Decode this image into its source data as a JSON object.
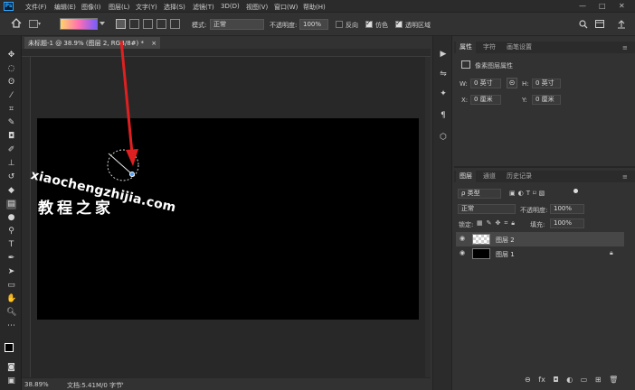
{
  "app": {
    "logo": "Ps"
  },
  "menu": [
    "文件(F)",
    "编辑(E)",
    "图像(I)",
    "图层(L)",
    "文字(Y)",
    "选择(S)",
    "滤镜(T)",
    "3D(D)",
    "视图(V)",
    "窗口(W)",
    "帮助(H)"
  ],
  "window_controls": {
    "minimize": "—",
    "maximize": "□",
    "close": "✕"
  },
  "options": {
    "mode_label": "模式:",
    "mode_value": "正常",
    "opacity_label": "不透明度:",
    "opacity_value": "100%",
    "reverse_label": "反向",
    "dither_label": "仿色",
    "transparency_label": "透明区域",
    "reverse_checked": false,
    "dither_checked": true,
    "transparency_checked": true,
    "gradient_colors": [
      "#ffd36b",
      "#ff6fb2",
      "#7a5cff"
    ]
  },
  "document": {
    "tab_title": "未标题-1 @ 38.9% (图层 2, RGB/8#) *",
    "tab_close": "×",
    "zoom": "38.89%",
    "doc_info": "文档:5.41M/0 字节"
  },
  "watermark": {
    "line1": "xiaochengzhijia.com",
    "line2": "教程之家"
  },
  "properties_panel": {
    "tabs": [
      "属性",
      "字符",
      "画笔设置"
    ],
    "section_title": "像素图层属性",
    "w_label": "W:",
    "w_value": "0 英寸",
    "h_label": "H:",
    "h_value": "0 英寸",
    "x_label": "X:",
    "x_value": "0 厘米",
    "y_label": "Y:",
    "y_value": "0 厘米",
    "link_icon": "⊝"
  },
  "layers_panel": {
    "tabs": [
      "图层",
      "通道",
      "历史记录"
    ],
    "filter_label": "ρ 类型",
    "blend_mode": "正常",
    "opacity_label": "不透明度:",
    "opacity_value": "100%",
    "lock_label": "锁定:",
    "fill_label": "填充:",
    "fill_value": "100%",
    "layers": [
      {
        "name": "图层 2",
        "selected": true,
        "thumb": "transparent"
      },
      {
        "name": "图层 1",
        "selected": false,
        "thumb": "black",
        "locked": true
      }
    ],
    "footer_icons": [
      "link-icon",
      "fx-icon",
      "mask-icon",
      "adjustment-icon",
      "group-icon",
      "new-layer-icon",
      "trash-icon"
    ]
  },
  "colors": {
    "accent": "#31a8ff",
    "arrow": "#e02020",
    "canvas": "#000000"
  }
}
